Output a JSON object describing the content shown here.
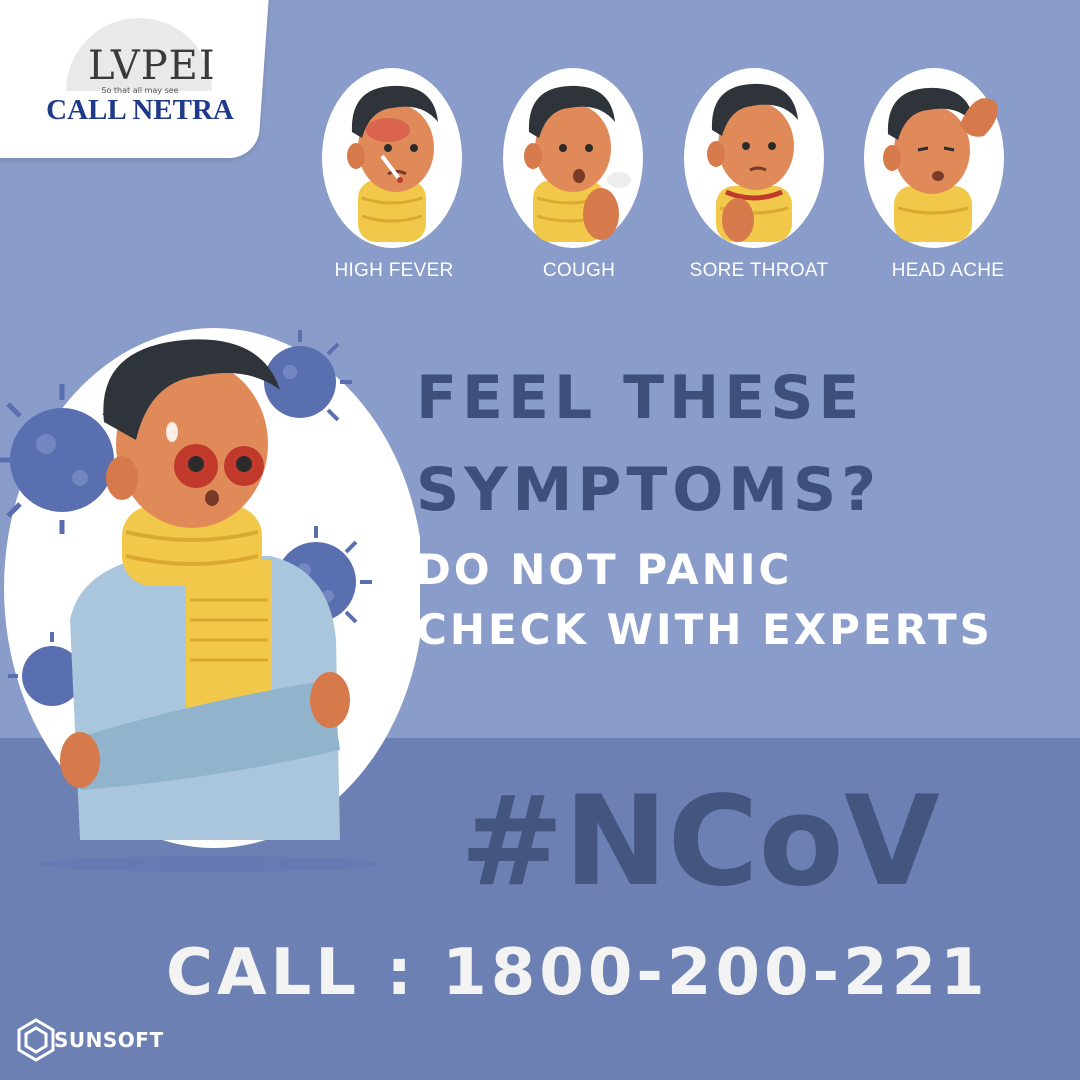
{
  "brand": {
    "logo_text": "LVPEI",
    "logo_tagline": "So that all may see",
    "logo_name": "CALL NETRA"
  },
  "symptoms": [
    {
      "label": "HIGH FEVER",
      "icon": "fever-face-icon"
    },
    {
      "label": "COUGH",
      "icon": "cough-face-icon"
    },
    {
      "label": "SORE THROAT",
      "icon": "sore-throat-face-icon"
    },
    {
      "label": "HEAD ACHE",
      "icon": "headache-face-icon"
    }
  ],
  "headline": {
    "line1": "FEEL THESE",
    "line2": "SYMPTOMS?"
  },
  "subhead": {
    "line1": "DO NOT PANIC",
    "line2": "CHECK WITH EXPERTS"
  },
  "hashtag": "#NCoV",
  "call": {
    "text": "CALL : 1800-200-221"
  },
  "footer": {
    "sponsor": "SUNSOFT"
  },
  "colors": {
    "background": "#8a9cc9",
    "band": "#6c80b4",
    "headline": "#3f4f7c",
    "hashtag": "#44557f",
    "virus": "#5a6fb0",
    "scarf": "#f2c84a",
    "brand_blue": "#1f3a8a"
  }
}
